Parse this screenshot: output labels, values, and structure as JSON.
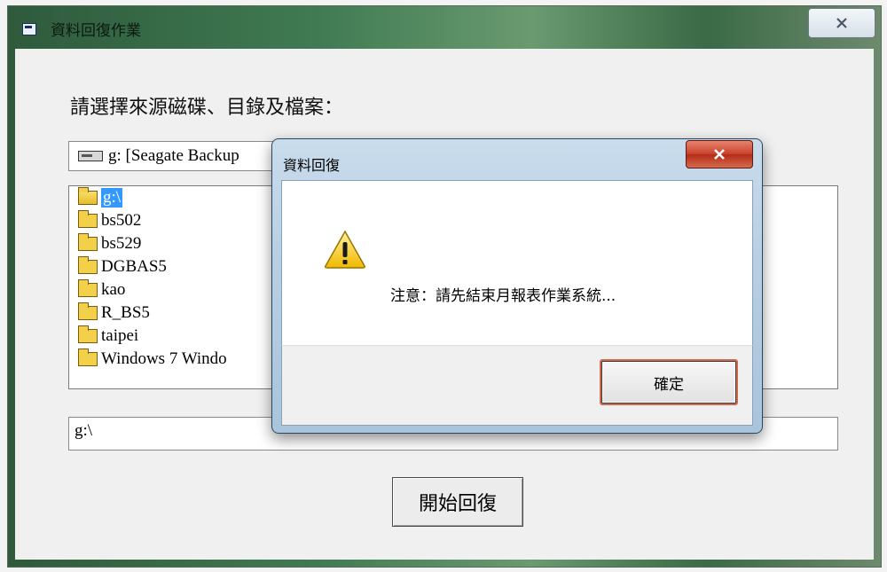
{
  "window": {
    "title": "資料回復作業",
    "close_icon": "close-icon"
  },
  "main": {
    "prompt": "請選擇來源磁碟、目錄及檔案：",
    "drive_select": {
      "value": "g: [Seagate Backup",
      "icon": "drive-icon"
    },
    "directories": [
      {
        "label": "g:\\",
        "icon": "folder-open-icon",
        "selected": true
      },
      {
        "label": "bs502",
        "icon": "folder-icon"
      },
      {
        "label": "bs529",
        "icon": "folder-icon"
      },
      {
        "label": "DGBAS5",
        "icon": "folder-icon"
      },
      {
        "label": "kao",
        "icon": "folder-icon"
      },
      {
        "label": "R_BS5",
        "icon": "folder-icon"
      },
      {
        "label": "taipei",
        "icon": "folder-icon"
      },
      {
        "label": "Windows 7 Windo",
        "icon": "folder-icon"
      }
    ],
    "path_value": "g:\\",
    "start_button": "開始回復"
  },
  "dialog": {
    "title": "資料回復",
    "close_icon": "close-icon",
    "warning_icon": "warning-icon",
    "message": "注意：請先結束月報表作業系統...",
    "ok_button": "確定",
    "accent_color": "#d06a4e"
  }
}
